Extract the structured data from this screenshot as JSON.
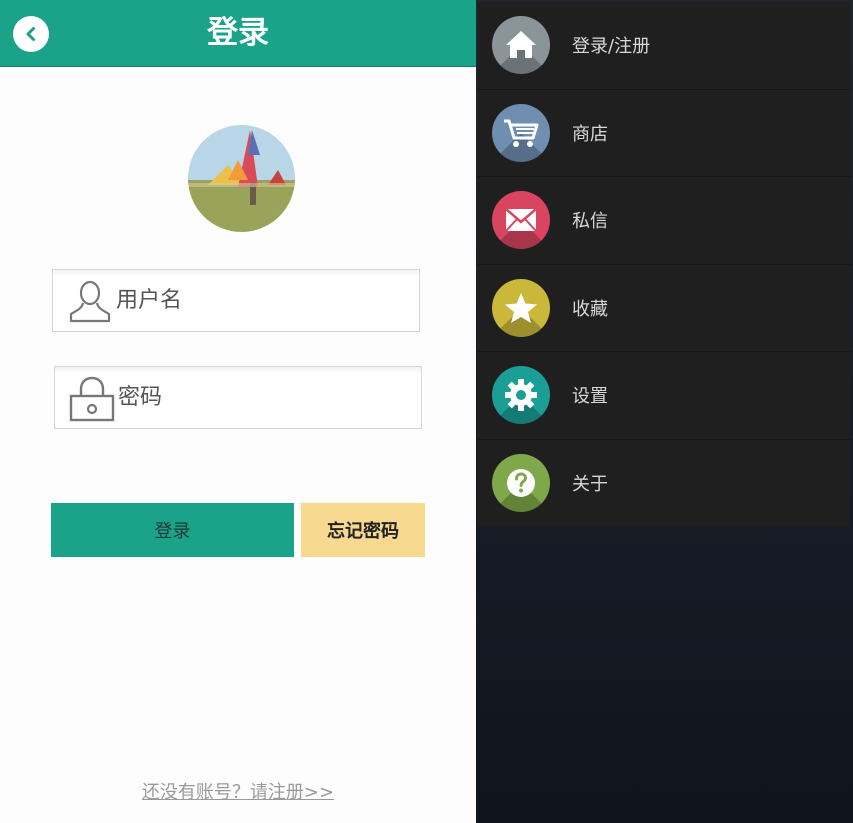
{
  "header": {
    "title": "登录"
  },
  "form": {
    "username_placeholder": "用户名",
    "password_placeholder": "密码",
    "login_label": "登录",
    "forgot_label": "忘记密码",
    "register_link": "还没有账号？请注册>>"
  },
  "drawer": {
    "items": [
      {
        "label": "登录/注册",
        "icon": "home-icon",
        "color": "#8a9499"
      },
      {
        "label": "商店",
        "icon": "cart-icon",
        "color": "#6f8eb0"
      },
      {
        "label": "私信",
        "icon": "mail-icon",
        "color": "#d94560"
      },
      {
        "label": "收藏",
        "icon": "star-icon",
        "color": "#c9b83a"
      },
      {
        "label": "设置",
        "icon": "gear-icon",
        "color": "#1a9e96"
      },
      {
        "label": "关于",
        "icon": "help-icon",
        "color": "#7fa84a"
      }
    ]
  },
  "colors": {
    "accent": "#1aa388",
    "forgot_button": "#f7da8f",
    "drawer_background": "#1f1f1f"
  }
}
